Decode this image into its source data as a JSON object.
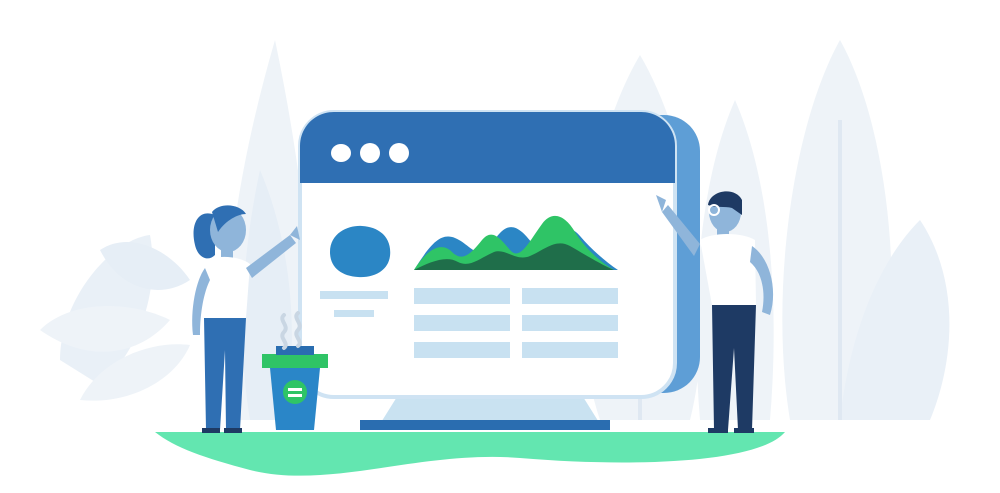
{
  "illustration": {
    "colors": {
      "background_foliage": "#eef3f8",
      "window_bar": "#2f6fb3",
      "window_body": "#ffffff",
      "window_shadow": "#5e9ed6",
      "window_outline": "#cfe3f3",
      "ground": "#63e6b0",
      "stand": "#c9e2f1",
      "stand_base": "#2a6db0",
      "mountain_blue": "#2b86c5",
      "mountain_green": "#2fc466",
      "mountain_dark": "#1f6e4a",
      "text_lines": "#c8e1f1",
      "person_skin": "#8fb5da",
      "person_pants_woman": "#2f6fb3",
      "person_pants_man": "#1e3a64",
      "cup_body": "#2a86c8",
      "cup_lid": "#2fc466"
    },
    "icons": [
      "window-dots-icon",
      "avatar-blob-icon",
      "mountain-chart-icon",
      "coffee-cup-icon",
      "steam-icon"
    ]
  }
}
